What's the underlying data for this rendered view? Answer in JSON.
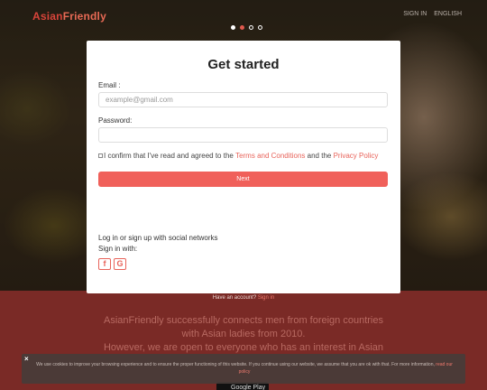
{
  "header": {
    "logo_part1": "Asian",
    "logo_part2": "Friendly",
    "sign_in": "SIGN IN",
    "language": "ENGLISH"
  },
  "carousel": {
    "slides": 4,
    "active_index": 1
  },
  "form": {
    "title": "Get started",
    "email_label": "Email :",
    "email_placeholder": "example@gmail.com",
    "password_label": "Password:",
    "confirm_prefix": "I confirm that I've read and agreed to the ",
    "terms_link": "Terms and Conditions",
    "confirm_and": " and the ",
    "privacy_link": "Privacy Policy",
    "next_label": "Next",
    "social_line1": "Log in or sign up with social networks",
    "social_line2": "Sign in with:",
    "facebook_label": "f",
    "google_label": "G"
  },
  "footer_note": {
    "text": "Have an account? ",
    "link": "Sign in"
  },
  "tagline": {
    "line1": "AsianFriendly successfully connects men from foreign countries",
    "line2": "with Asian ladies from 2010.",
    "line3": "However, we are open to everyone who has an interest in Asian"
  },
  "cookie": {
    "close": "×",
    "text": "We use cookies to improve your browsing experience and to ensure the proper functioning of this website. If you continue using our website, we assume that you are ok with that. For more information, ",
    "link": "read our policy"
  },
  "store_badge": "Google Play",
  "colors": {
    "accent": "#f0605a",
    "lower_bg": "#7a2a26",
    "logo": "#d8443a"
  }
}
